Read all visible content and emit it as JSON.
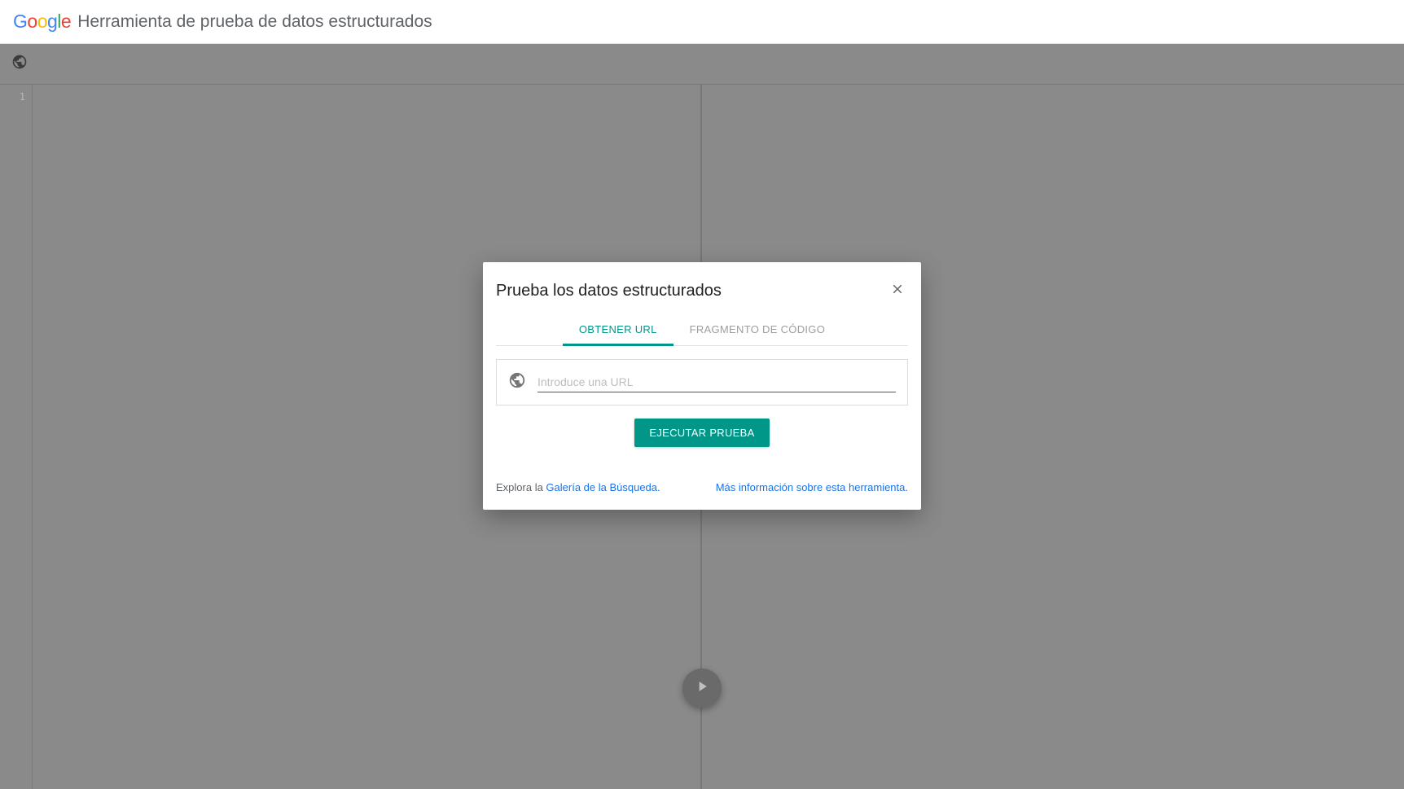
{
  "header": {
    "logo_text": "Google",
    "title": "Herramienta de prueba de datos estructurados"
  },
  "editor": {
    "line_number": "1"
  },
  "dialog": {
    "title": "Prueba los datos estructurados",
    "tabs": {
      "fetch_url": "OBTENER URL",
      "code_snippet": "FRAGMENTO DE CÓDIGO"
    },
    "input_placeholder": "Introduce una URL",
    "run_button": "EJECUTAR PRUEBA",
    "footer": {
      "explore_prefix": "Explora la ",
      "gallery_link": "Galería de la Búsqueda.",
      "more_info": "Más información sobre esta herramienta."
    }
  }
}
